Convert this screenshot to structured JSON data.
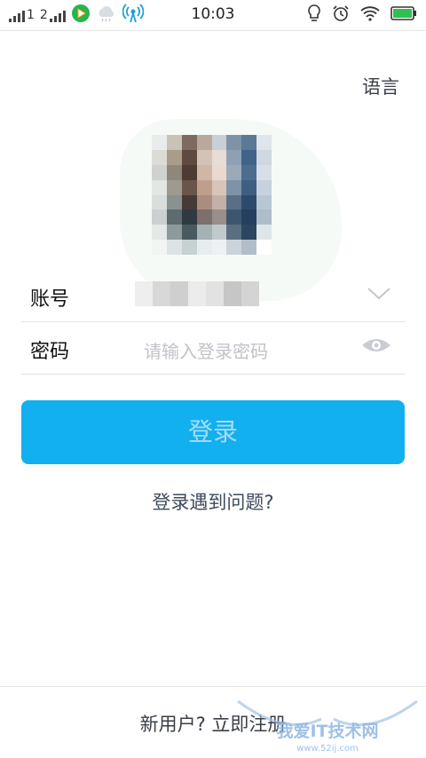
{
  "status_bar": {
    "time": "10:03",
    "sim1_label": "1",
    "sim2_label": "2",
    "icons": [
      "signal-icon",
      "signal-icon",
      "video-app-icon",
      "cloud-icon",
      "hotspot-icon",
      "bulb-icon",
      "alarm-icon",
      "wifi-icon",
      "battery-icon"
    ]
  },
  "header": {
    "language_label": "语言"
  },
  "form": {
    "account_label": "账号",
    "password_label": "密码",
    "password_placeholder": "请输入登录密码"
  },
  "login_button": "登录",
  "trouble_link": "登录遇到问题?",
  "register_link": "新用户? 立即注册",
  "watermark": {
    "text": "我爱IT技术网",
    "sub": "www.52ij.com"
  },
  "colors": {
    "accent": "#12b0ef",
    "button_text": "#a8dcf4",
    "text_dark": "#3a3f47"
  }
}
